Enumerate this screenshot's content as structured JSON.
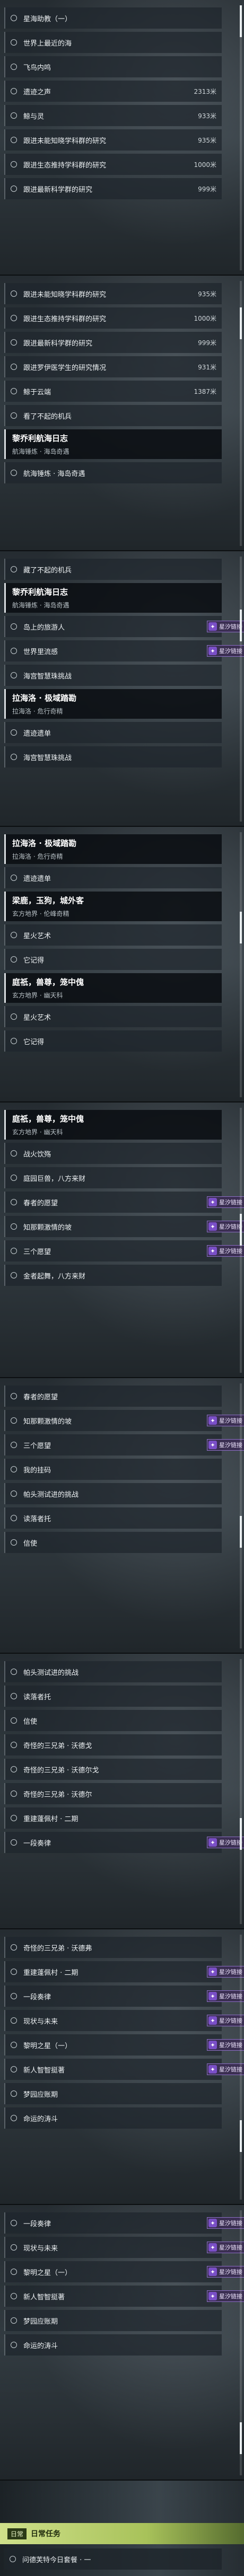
{
  "badge_label": "星汐链接",
  "screens": [
    {
      "items": [
        {
          "type": "item",
          "label": "星海助教（一）"
        },
        {
          "type": "item",
          "label": "世界上最近的海"
        },
        {
          "type": "item",
          "label": "飞鸟内鸣"
        },
        {
          "type": "item",
          "label": "遗迹之声",
          "value": "2313米"
        },
        {
          "type": "item",
          "label": "鲸与灵",
          "value": "933米"
        },
        {
          "type": "item",
          "label": "跟进未能知晓学科群的研究",
          "value": "935米"
        },
        {
          "type": "item",
          "label": "跟进生态推持学科群的研究",
          "value": "1000米"
        },
        {
          "type": "item",
          "label": "跟进最新科学群的研究",
          "value": "999米"
        }
      ]
    },
    {
      "items": [
        {
          "type": "item",
          "label": "跟进未能知晓学科群的研究",
          "value": "935米"
        },
        {
          "type": "item",
          "label": "跟进生态推持学科群的研究",
          "value": "1000米"
        },
        {
          "type": "item",
          "label": "跟进最新科学群的研究",
          "value": "999米"
        },
        {
          "type": "item",
          "label": "跟进罗伊医学生的研究情况",
          "value": "931米"
        },
        {
          "type": "item",
          "label": "鲸于云端",
          "value": "1387米"
        },
        {
          "type": "item",
          "label": "看了不起的机兵"
        },
        {
          "type": "header",
          "title": "黎乔利航海日志",
          "sub": "航海锤炼 · 海岛奇遇"
        },
        {
          "type": "item",
          "label": "航海锤炼 · 海岛奇遇"
        }
      ]
    },
    {
      "items": [
        {
          "type": "item",
          "label": "藏了不起的机兵"
        },
        {
          "type": "header",
          "title": "黎乔利航海日志",
          "sub": "航海锤炼 · 海岛奇遇"
        },
        {
          "type": "item",
          "label": "岛上的旅游人",
          "badge": true
        },
        {
          "type": "item",
          "label": "世界里流感",
          "badge": true
        },
        {
          "type": "item",
          "label": "海宫智慧珠挑战"
        },
        {
          "type": "header",
          "title": "拉海洛 · 极域踏勘",
          "sub": "拉海洛 · 危行奇精"
        },
        {
          "type": "item",
          "label": "遗迹遗单"
        },
        {
          "type": "item",
          "label": "海宫智慧珠挑战"
        }
      ]
    },
    {
      "items": [
        {
          "type": "header",
          "title": "拉海洛 · 极域踏勘",
          "sub": "拉海洛 · 危行奇精"
        },
        {
          "type": "item",
          "label": "遗迹遗单"
        },
        {
          "type": "header",
          "title": "梁鹿，玉狗，城外客",
          "sub": "玄方地界 · 伦峰奇精"
        },
        {
          "type": "item",
          "label": "星火艺术"
        },
        {
          "type": "item",
          "label": "它记得"
        },
        {
          "type": "header",
          "title": "庭祇，兽尊，笼中傀",
          "sub": "玄方地界 · 幽天科"
        },
        {
          "type": "item",
          "label": "星火艺术"
        },
        {
          "type": "item",
          "label": "它记得"
        }
      ]
    },
    {
      "items": [
        {
          "type": "header",
          "title": "庭祇，兽尊，笼中傀",
          "sub": "玄方地界 · 幽天科"
        },
        {
          "type": "item",
          "label": "战火饮殇"
        },
        {
          "type": "item",
          "label": "庭园巨兽，八方来财"
        },
        {
          "type": "item",
          "label": "春者的愿望",
          "badge": true
        },
        {
          "type": "item",
          "label": "知那颗激情的坡",
          "badge": true
        },
        {
          "type": "item",
          "label": "三个愿望",
          "badge": true
        },
        {
          "type": "item",
          "label": "金者起舞，八方来财"
        }
      ]
    },
    {
      "items": [
        {
          "type": "item",
          "label": "春者的愿望"
        },
        {
          "type": "item",
          "label": "知那颗激情的坡",
          "badge": true
        },
        {
          "type": "item",
          "label": "三个愿望",
          "badge": true
        },
        {
          "type": "item",
          "label": "我的挂码"
        },
        {
          "type": "item",
          "label": "帕头测试进的挑战"
        },
        {
          "type": "item",
          "label": "读落者托"
        },
        {
          "type": "item",
          "label": "信使"
        }
      ]
    },
    {
      "items": [
        {
          "type": "item",
          "label": "帕头测试进的挑战"
        },
        {
          "type": "item",
          "label": "读落者托"
        },
        {
          "type": "item",
          "label": "信使"
        },
        {
          "type": "item",
          "label": "奇怪的三兄弟 · 沃德戈"
        },
        {
          "type": "item",
          "label": "奇怪的三兄弟 · 沃德尔戈"
        },
        {
          "type": "item",
          "label": "奇怪的三兄弟 · 沃德尔"
        },
        {
          "type": "item",
          "label": "重建蓬佩村 · 二期"
        },
        {
          "type": "item",
          "label": "一段奏律",
          "badge": true
        }
      ]
    },
    {
      "items": [
        {
          "type": "item",
          "label": "奇怪的三兄弟 · 沃德弗"
        },
        {
          "type": "item",
          "label": "重建蓬佩村 · 二期",
          "badge": true
        },
        {
          "type": "item",
          "label": "一段奏律",
          "badge": true
        },
        {
          "type": "item",
          "label": "现状与未来",
          "badge": true
        },
        {
          "type": "item",
          "label": "黎明之星（一）",
          "badge": true
        },
        {
          "type": "item",
          "label": "新人智智挺著",
          "badge": true
        },
        {
          "type": "item",
          "label": "梦园应账期"
        },
        {
          "type": "item",
          "label": "命运的涛斗"
        }
      ]
    },
    {
      "items": [
        {
          "type": "item",
          "label": "一段奏律",
          "badge": true
        },
        {
          "type": "item",
          "label": "现状与未来",
          "badge": true
        },
        {
          "type": "item",
          "label": "黎明之星（一）",
          "badge": true
        },
        {
          "type": "item",
          "label": "新人智智挺著",
          "badge": true
        },
        {
          "type": "item",
          "label": "梦园应账期"
        },
        {
          "type": "item",
          "label": "命运的涛斗"
        }
      ]
    }
  ],
  "footer": {
    "tag": "日常",
    "title": "日常任务"
  },
  "footer_item": "问德芙特今日套餐 · 一"
}
